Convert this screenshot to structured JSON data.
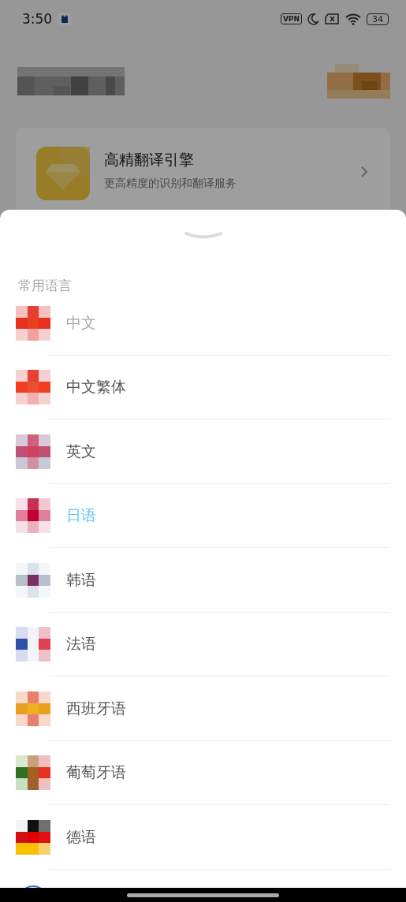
{
  "status_bar": {
    "time": "3:50",
    "vpn": "VPN",
    "battery": "34"
  },
  "engine_card": {
    "title": "高精翻译引擎",
    "subtitle": "更高精度的识别和翻译服务"
  },
  "sheet": {
    "section_title": "常用语言",
    "languages": [
      {
        "label": "中文",
        "selected": false,
        "disabled": true
      },
      {
        "label": "中文繁体",
        "selected": false,
        "disabled": false
      },
      {
        "label": "英文",
        "selected": false,
        "disabled": false
      },
      {
        "label": "日语",
        "selected": true,
        "disabled": false
      },
      {
        "label": "韩语",
        "selected": false,
        "disabled": false
      },
      {
        "label": "法语",
        "selected": false,
        "disabled": false
      },
      {
        "label": "西班牙语",
        "selected": false,
        "disabled": false
      },
      {
        "label": "葡萄牙语",
        "selected": false,
        "disabled": false
      },
      {
        "label": "德语",
        "selected": false,
        "disabled": false
      }
    ]
  }
}
